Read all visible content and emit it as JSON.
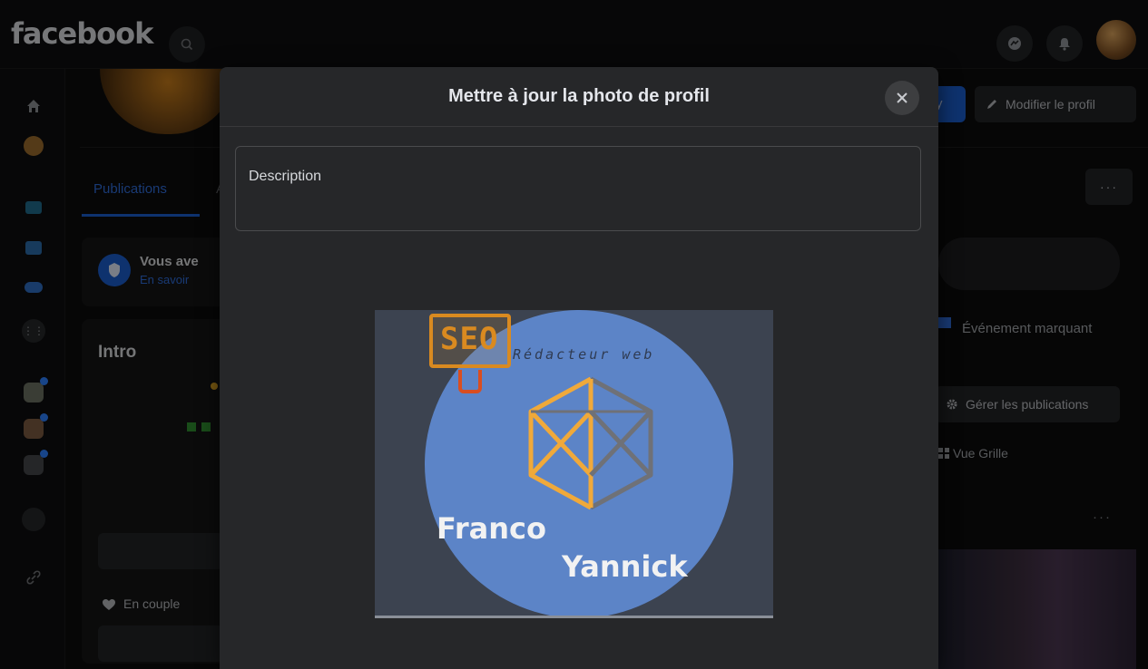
{
  "topbar": {
    "logo": "facebook"
  },
  "background": {
    "tab_publications": "Publications",
    "tab_partial": "A",
    "notice_title": "Vous ave",
    "notice_link": "En savoir",
    "intro_heading": "Intro",
    "relationship": "En couple",
    "edit_profile_label": "Modifier le profil",
    "story_partial": "ry",
    "more_dots": "···",
    "event_label": "Événement marquant",
    "manage_posts_label": "Gérer les publications",
    "grid_view_label": "Vue Grille"
  },
  "modal": {
    "title": "Mettre à jour la photo de profil",
    "description_placeholder": "Description",
    "photo": {
      "seo_label": "SEO",
      "subtitle": "Rédacteur web",
      "name_line1": "Franco",
      "name_line2": "Yannick"
    }
  },
  "colors": {
    "accent_blue": "#1b5bc8",
    "modal_bg": "#262729",
    "crop_circle": "#5c84c7",
    "logo_orange": "#d98a20"
  },
  "icons": [
    "search-icon",
    "messenger-icon",
    "bell-icon",
    "home-icon",
    "watch-icon",
    "marketplace-icon",
    "gaming-icon",
    "menu-grid-icon",
    "groups-icon",
    "link-icon",
    "pencil-icon",
    "gear-icon",
    "grid-icon",
    "heart-icon",
    "shield-icon",
    "close-icon"
  ]
}
